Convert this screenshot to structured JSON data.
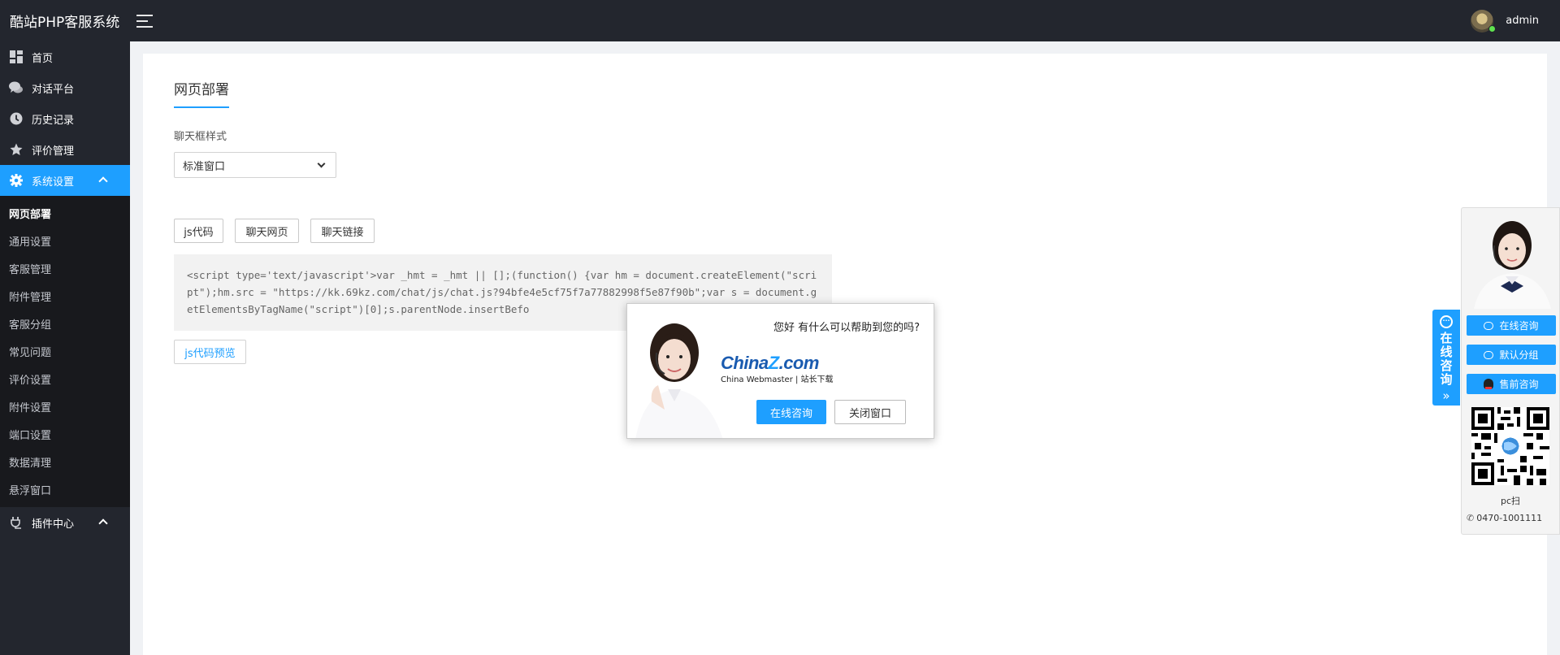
{
  "header": {
    "logo": "酷站PHP客服系统",
    "username": "admin"
  },
  "sidebar": {
    "items": [
      {
        "label": "首页",
        "icon": "dashboard-icon"
      },
      {
        "label": "对话平台",
        "icon": "chat-icon"
      },
      {
        "label": "历史记录",
        "icon": "clock-icon"
      },
      {
        "label": "评价管理",
        "icon": "star-icon"
      },
      {
        "label": "系统设置",
        "icon": "gear-icon"
      }
    ],
    "submenu": [
      "网页部署",
      "通用设置",
      "客服管理",
      "附件管理",
      "客服分组",
      "常见问题",
      "评价设置",
      "附件设置",
      "端口设置",
      "数据清理",
      "悬浮窗口"
    ],
    "plugin": {
      "label": "插件中心",
      "icon": "plug-icon"
    }
  },
  "main": {
    "title": "网页部署",
    "style_label": "聊天框样式",
    "style_value": "标准窗口",
    "tabs": [
      "js代码",
      "聊天网页",
      "聊天链接"
    ],
    "code": "<script type='text/javascript'>var _hmt = _hmt || [];(function() {var hm = document.createElement(\"script\");hm.src = \"https://kk.69kz.com/chat/js/chat.js?94bfe4e5cf75f7a77882998f5e87f90b\";var s = document.getElementsByTagName(\"script\")[0];s.parentNode.insertBefo",
    "preview_label": "js代码预览"
  },
  "popup": {
    "message": "您好 有什么可以帮助到您的吗?",
    "brand_a": "China",
    "brand_z": "Z",
    "brand_b": ".com",
    "brand_sub": "China Webmaster | 站长下载",
    "primary_label": "在线咨询",
    "secondary_label": "关闭窗口"
  },
  "float": {
    "tab_text": "在线咨询",
    "buttons": [
      "在线咨询",
      "默认分组",
      "售前咨询"
    ],
    "scan_text": "pc扫",
    "phone": "0470-1001111"
  },
  "colors": {
    "accent": "#1e9fff",
    "sidebar_bg": "#23262e",
    "submenu_bg": "#18191d"
  }
}
